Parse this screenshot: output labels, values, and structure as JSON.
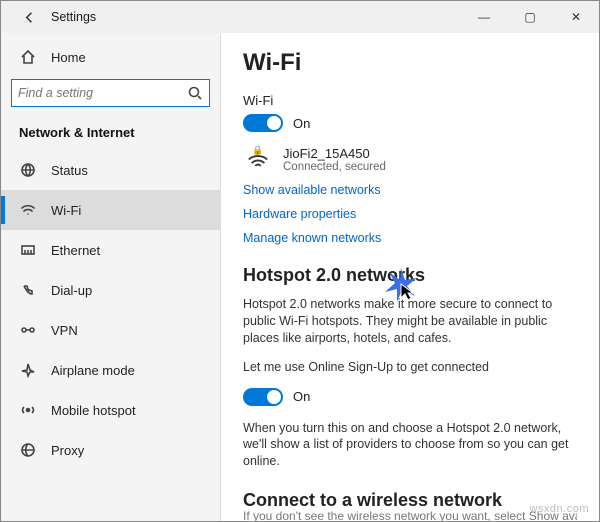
{
  "window": {
    "title": "Settings",
    "controls": {
      "minimize": "—",
      "maximize": "▢",
      "close": "✕"
    }
  },
  "sidebar": {
    "home_label": "Home",
    "search_placeholder": "Find a setting",
    "section_header": "Network & Internet",
    "items": [
      {
        "key": "status",
        "label": "Status"
      },
      {
        "key": "wifi",
        "label": "Wi-Fi"
      },
      {
        "key": "ethernet",
        "label": "Ethernet"
      },
      {
        "key": "dialup",
        "label": "Dial-up"
      },
      {
        "key": "vpn",
        "label": "VPN"
      },
      {
        "key": "airplane",
        "label": "Airplane mode"
      },
      {
        "key": "hotspot",
        "label": "Mobile hotspot"
      },
      {
        "key": "proxy",
        "label": "Proxy"
      }
    ]
  },
  "main": {
    "page_title": "Wi-Fi",
    "wifi_toggle": {
      "label": "Wi-Fi",
      "state": "On"
    },
    "network": {
      "ssid": "JioFi2_15A450",
      "state": "Connected, secured"
    },
    "links": {
      "show_available": "Show available networks",
      "hw_props": "Hardware properties",
      "manage_known": "Manage known networks"
    },
    "hotspot2": {
      "heading": "Hotspot 2.0 networks",
      "desc": "Hotspot 2.0 networks make it more secure to connect to public Wi-Fi hotspots. They might be available in public places like airports, hotels, and cafes.",
      "signup_label": "Let me use Online Sign-Up to get connected",
      "signup_state": "On",
      "note": "When you turn this on and choose a Hotspot 2.0 network, we'll show a list of providers to choose from so you can get online."
    },
    "connect_heading": "Connect to a wireless network",
    "truncated": "If you don't see the wireless network you want, select Show available netwo"
  },
  "watermark": "wsxdn.com"
}
